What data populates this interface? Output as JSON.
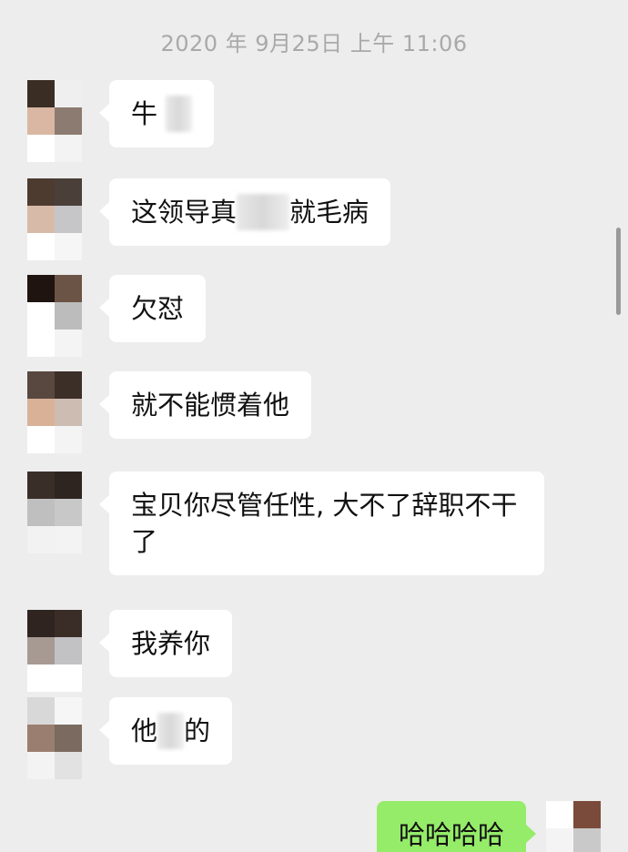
{
  "chat": {
    "timestamp": "2020 年 9月25日 上午 11:06",
    "messages": [
      {
        "text": "牛 ",
        "masked": "",
        "tail": "",
        "avatar": [
          "#3a2d24",
          "#efeff0",
          "#d9b7a2",
          "#8c7b70",
          "#ffffff",
          "#f3f3f3"
        ]
      },
      {
        "text": "这领导真",
        "masked": "",
        "tail": "就毛病",
        "avatar": [
          "#4d3b30",
          "#4a3f39",
          "#d8baa9",
          "#c6c6c8",
          "#ffffff",
          "#f6f6f6"
        ]
      },
      {
        "text": "欠怼",
        "masked": "",
        "tail": "",
        "avatar": [
          "#1f140f",
          "#6b5446",
          "#ffffff",
          "#bcbcbc",
          "#ffffff",
          "#f4f4f4"
        ]
      },
      {
        "text": "就不能惯着他",
        "masked": "",
        "tail": "",
        "avatar": [
          "#584840",
          "#3c2f28",
          "#d9b197",
          "#cdbcb2",
          "#ffffff",
          "#f4f4f4"
        ]
      },
      {
        "text": "宝贝你尽管任性, 大不了辞职不干了",
        "masked": "",
        "tail": "",
        "avatar": [
          "#3a2e28",
          "#2e2520",
          "#bfbfbf",
          "#c8c8c8",
          "#f2f2f2",
          "#f3f3f3"
        ]
      },
      {
        "text": "我养你",
        "masked": "",
        "tail": "",
        "avatar": [
          "#2f241f",
          "#3a2d27",
          "#a79a92",
          "#c2c2c5",
          "#ffffff",
          "#ffffff"
        ]
      },
      {
        "text": "他",
        "masked": "",
        "tail": "的",
        "avatar": [
          "#d8d8d8",
          "#f6f6f6",
          "#9a7e70",
          "#7a6a60",
          "#f3f3f3",
          "#e2e2e2"
        ]
      }
    ],
    "outgoing": {
      "text": "哈哈哈哈",
      "avatar": [
        "#ffffff",
        "#7a4b3a",
        "#f4f4f4",
        "#c9c9c9",
        "#ffffff",
        "#ffffff"
      ]
    }
  }
}
